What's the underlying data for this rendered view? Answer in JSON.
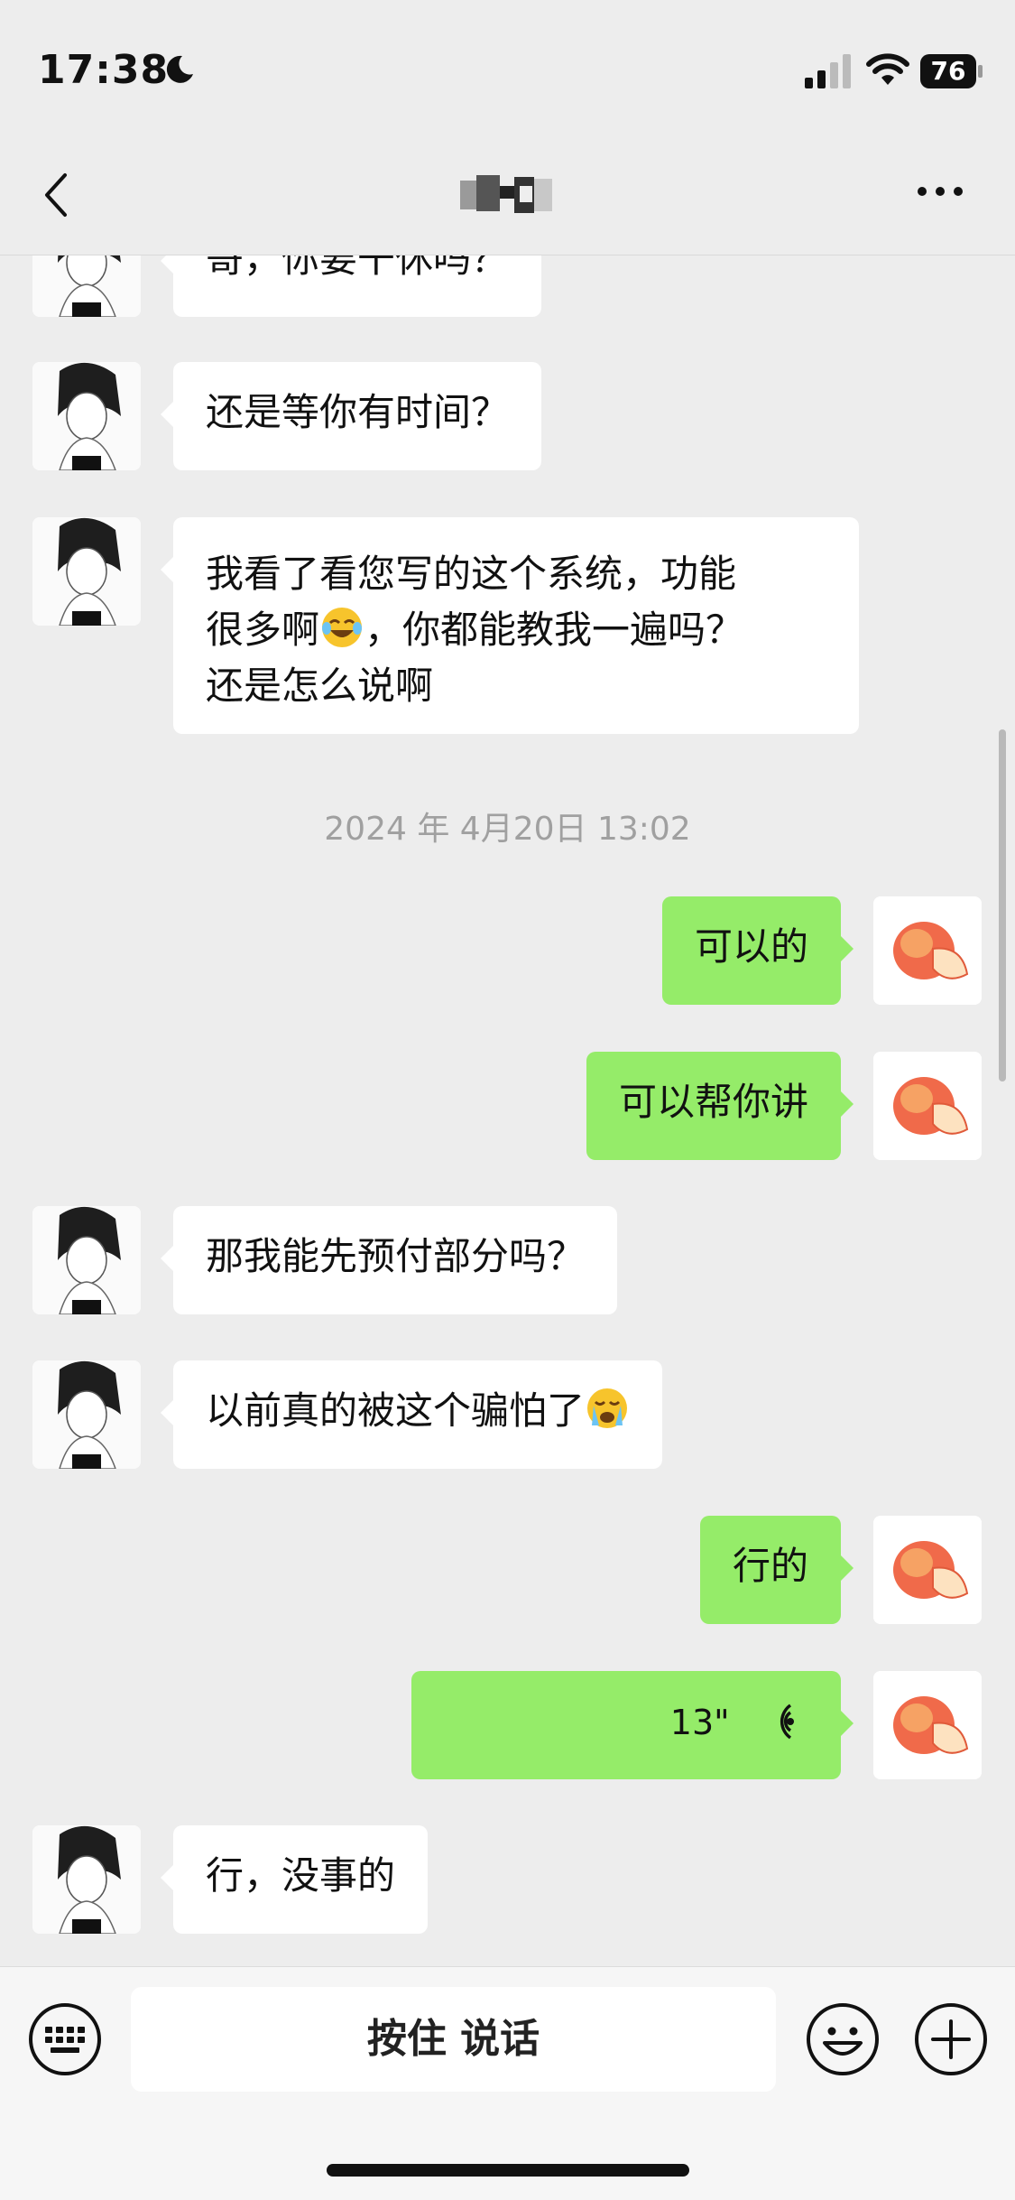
{
  "status_bar": {
    "time": "17:38",
    "battery": "76"
  },
  "nav": {
    "title": ""
  },
  "messages": [
    {
      "side": "in",
      "text": "哥，你要干休吗？"
    },
    {
      "side": "in",
      "text": "还是等你有时间？"
    },
    {
      "side": "in",
      "lines": [
        "我看了看您写的这个系统，功能",
        "很多啊",
        "，你都能教我一遍吗？",
        "还是怎么说啊"
      ]
    },
    {
      "side": "out",
      "text": "可以的"
    },
    {
      "side": "out",
      "text": "可以帮你讲"
    },
    {
      "side": "in",
      "text": "那我能先预付部分吗？"
    },
    {
      "side": "in",
      "text": "以前真的被这个骗怕了"
    },
    {
      "side": "out",
      "text": "行的"
    },
    {
      "side": "out",
      "voice_duration": "13\""
    },
    {
      "side": "in",
      "text": "行，没事的"
    }
  ],
  "timestamp": "2024 年 4月20日 13:02",
  "input": {
    "hold_to_talk": "按住 说话"
  },
  "icons": {
    "back": "chevron-left-icon",
    "more": "more-dots-icon",
    "keyboard": "keyboard-icon",
    "emoji": "smiley-icon",
    "plus": "plus-icon",
    "voice": "voice-wave-icon"
  },
  "colors": {
    "outgoing_bubble": "#95ec69",
    "incoming_bubble": "#ffffff",
    "background": "#ededed"
  }
}
